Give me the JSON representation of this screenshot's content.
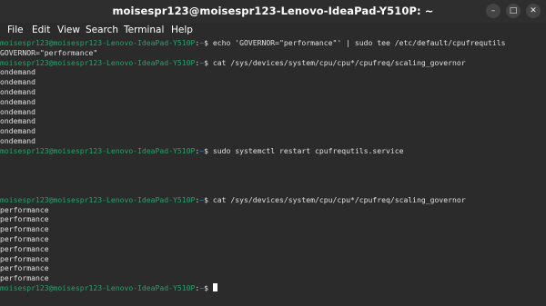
{
  "window": {
    "title": "moisespr123@moisespr123-Lenovo-IdeaPad-Y510P: ~",
    "minimize_glyph": "–",
    "maximize_glyph": "□",
    "close_glyph": "✕"
  },
  "menu": {
    "file": "File",
    "edit": "Edit",
    "view": "View",
    "search": "Search",
    "terminal": "Terminal",
    "help": "Help"
  },
  "prompt": {
    "user_host": "moisespr123@moisespr123-Lenovo-IdeaPad-Y510P",
    "path": "~",
    "symbol": "$"
  },
  "lines": [
    {
      "type": "prompt",
      "command": "echo 'GOVERNOR=\"performance\"' | sudo tee /etc/default/cpufrequtils"
    },
    {
      "type": "output",
      "text": "GOVERNOR=\"performance\""
    },
    {
      "type": "prompt",
      "command": "cat /sys/devices/system/cpu/cpu*/cpufreq/scaling_governor"
    },
    {
      "type": "output",
      "text": "ondemand"
    },
    {
      "type": "output",
      "text": "ondemand"
    },
    {
      "type": "output",
      "text": "ondemand"
    },
    {
      "type": "output",
      "text": "ondemand"
    },
    {
      "type": "output",
      "text": "ondemand"
    },
    {
      "type": "output",
      "text": "ondemand"
    },
    {
      "type": "output",
      "text": "ondemand"
    },
    {
      "type": "output",
      "text": "ondemand"
    },
    {
      "type": "prompt",
      "command": "sudo systemctl restart cpufrequtils.service"
    },
    {
      "type": "output",
      "text": ""
    },
    {
      "type": "output",
      "text": ""
    },
    {
      "type": "output",
      "text": ""
    },
    {
      "type": "output",
      "text": ""
    },
    {
      "type": "prompt",
      "command": "cat /sys/devices/system/cpu/cpu*/cpufreq/scaling_governor"
    },
    {
      "type": "output",
      "text": "performance"
    },
    {
      "type": "output",
      "text": "performance"
    },
    {
      "type": "output",
      "text": "performance"
    },
    {
      "type": "output",
      "text": "performance"
    },
    {
      "type": "output",
      "text": "performance"
    },
    {
      "type": "output",
      "text": "performance"
    },
    {
      "type": "output",
      "text": "performance"
    },
    {
      "type": "output",
      "text": "performance"
    },
    {
      "type": "prompt",
      "command": "",
      "cursor": true
    }
  ],
  "colors": {
    "prompt_user": "#26a269",
    "prompt_path": "#3584e4",
    "text": "#e0e0e0",
    "background": "#2b2b2b"
  }
}
